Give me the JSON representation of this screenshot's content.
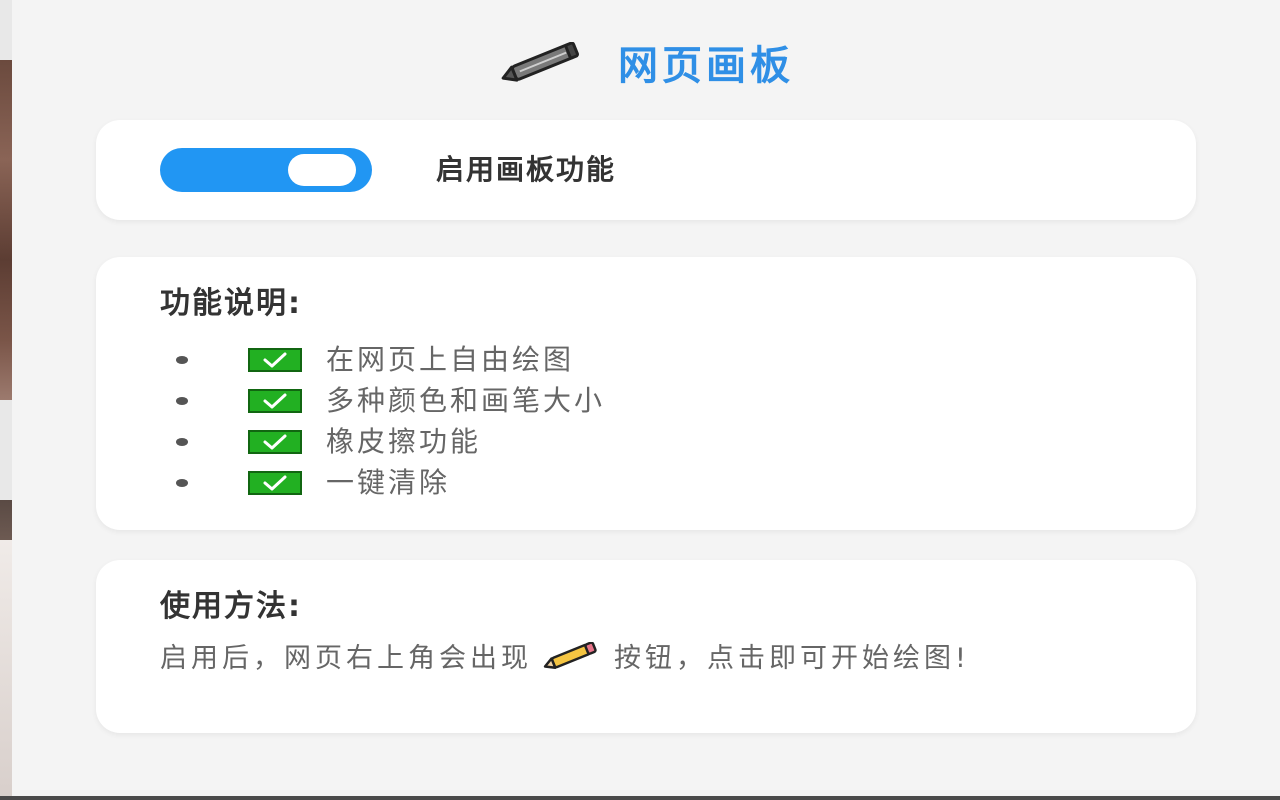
{
  "header": {
    "title": "网页画板",
    "icon": "pencil-icon"
  },
  "toggle_card": {
    "enabled": true,
    "label": "启用画板功能",
    "accent": "#2196f3"
  },
  "features": {
    "heading": "功能说明:",
    "items": [
      {
        "label": "在网页上自由绘图",
        "icon": "check-mark-icon"
      },
      {
        "label": "多种颜色和画笔大小",
        "icon": "check-mark-icon"
      },
      {
        "label": "橡皮擦功能",
        "icon": "check-mark-icon"
      },
      {
        "label": "一键清除",
        "icon": "check-mark-icon"
      }
    ]
  },
  "usage": {
    "heading": "使用方法:",
    "text_before": "启用后，网页右上角会出现",
    "icon": "pencil-icon",
    "text_after": "按钮，点击即可开始绘图!"
  },
  "colors": {
    "title": "#2f8fe6",
    "background": "#f4f4f4",
    "card": "#ffffff",
    "check": "#22b022"
  }
}
